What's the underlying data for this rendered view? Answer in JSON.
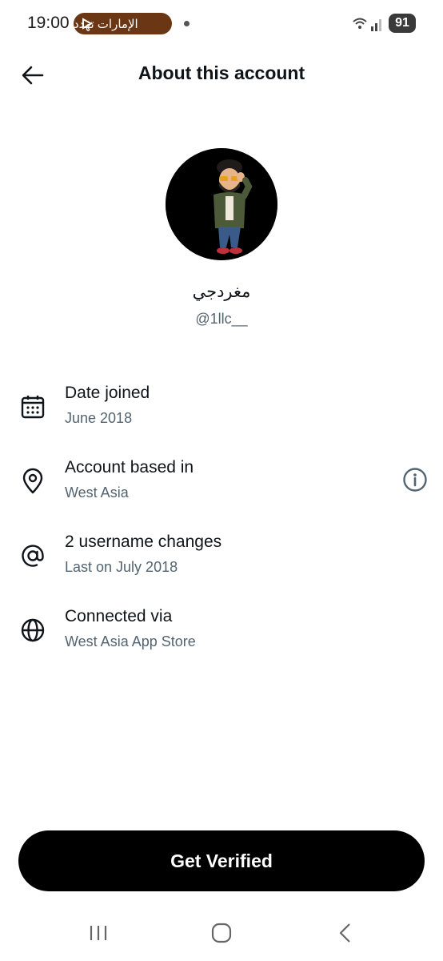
{
  "status_bar": {
    "time": "19:00",
    "notification_pill": "الإمارات تهدد",
    "battery": "91"
  },
  "header": {
    "title": "About this account"
  },
  "profile": {
    "display_name": "مغردجي",
    "handle": "@1llc__"
  },
  "rows": [
    {
      "icon": "calendar-icon",
      "label": "Date joined",
      "value": "June 2018"
    },
    {
      "icon": "location-pin-icon",
      "label": "Account based in",
      "value": "West Asia"
    },
    {
      "icon": "at-sign-icon",
      "label": "2 username changes",
      "value": "Last on July 2018"
    },
    {
      "icon": "globe-icon",
      "label": "Connected via",
      "value": "West Asia App Store"
    }
  ],
  "cta": {
    "label": "Get Verified"
  },
  "colors": {
    "pill": "#6b3614",
    "secondary_text": "#536471",
    "button": "#000000"
  }
}
